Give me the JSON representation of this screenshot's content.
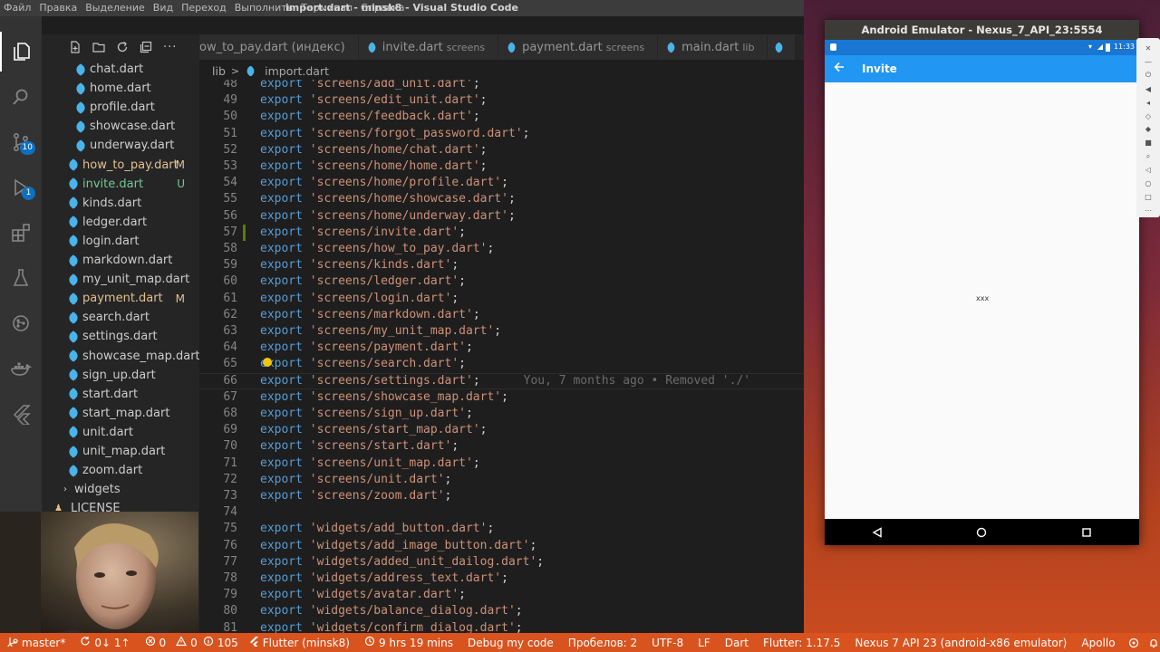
{
  "titlebar": {
    "menu": [
      "Файл",
      "Правка",
      "Выделение",
      "Вид",
      "Переход",
      "Выполнить",
      "Терминал",
      "Справка"
    ],
    "title": "import.dart - minsk8 - Visual Studio Code"
  },
  "activitybar": {
    "items": [
      {
        "name": "explorer-icon",
        "badge": ""
      },
      {
        "name": "search-icon",
        "badge": ""
      },
      {
        "name": "source-control-icon",
        "badge": "10"
      },
      {
        "name": "run-debug-icon",
        "badge": "1"
      },
      {
        "name": "extensions-icon",
        "badge": ""
      },
      {
        "name": "testing-flask-icon",
        "badge": ""
      },
      {
        "name": "git-graph-icon",
        "badge": ""
      },
      {
        "name": "docker-icon",
        "badge": ""
      },
      {
        "name": "flutter-icon",
        "badge": ""
      }
    ]
  },
  "explorer": {
    "actions": [
      "new-file-icon",
      "new-folder-icon",
      "refresh-icon",
      "collapse-icon",
      "more-icon"
    ],
    "items": [
      {
        "label": "chat.dart",
        "indent": 2,
        "mod": "",
        "color": "#cccccc",
        "kind": "file"
      },
      {
        "label": "home.dart",
        "indent": 2,
        "mod": "",
        "color": "#cccccc",
        "kind": "file"
      },
      {
        "label": "profile.dart",
        "indent": 2,
        "mod": "",
        "color": "#cccccc",
        "kind": "file"
      },
      {
        "label": "showcase.dart",
        "indent": 2,
        "mod": "",
        "color": "#cccccc",
        "kind": "file"
      },
      {
        "label": "underway.dart",
        "indent": 2,
        "mod": "",
        "color": "#cccccc",
        "kind": "file"
      },
      {
        "label": "how_to_pay.dart",
        "indent": 1,
        "mod": "M",
        "color": "#e2c08d",
        "kind": "file"
      },
      {
        "label": "invite.dart",
        "indent": 1,
        "mod": "U",
        "color": "#73c991",
        "kind": "file"
      },
      {
        "label": "kinds.dart",
        "indent": 1,
        "mod": "",
        "color": "#cccccc",
        "kind": "file"
      },
      {
        "label": "ledger.dart",
        "indent": 1,
        "mod": "",
        "color": "#cccccc",
        "kind": "file"
      },
      {
        "label": "login.dart",
        "indent": 1,
        "mod": "",
        "color": "#cccccc",
        "kind": "file"
      },
      {
        "label": "markdown.dart",
        "indent": 1,
        "mod": "",
        "color": "#cccccc",
        "kind": "file"
      },
      {
        "label": "my_unit_map.dart",
        "indent": 1,
        "mod": "",
        "color": "#cccccc",
        "kind": "file"
      },
      {
        "label": "payment.dart",
        "indent": 1,
        "mod": "M",
        "color": "#e2c08d",
        "kind": "file"
      },
      {
        "label": "search.dart",
        "indent": 1,
        "mod": "",
        "color": "#cccccc",
        "kind": "file"
      },
      {
        "label": "settings.dart",
        "indent": 1,
        "mod": "",
        "color": "#cccccc",
        "kind": "file"
      },
      {
        "label": "showcase_map.dart",
        "indent": 1,
        "mod": "",
        "color": "#cccccc",
        "kind": "file"
      },
      {
        "label": "sign_up.dart",
        "indent": 1,
        "mod": "",
        "color": "#cccccc",
        "kind": "file"
      },
      {
        "label": "start.dart",
        "indent": 1,
        "mod": "",
        "color": "#cccccc",
        "kind": "file"
      },
      {
        "label": "start_map.dart",
        "indent": 1,
        "mod": "",
        "color": "#cccccc",
        "kind": "file"
      },
      {
        "label": "unit.dart",
        "indent": 1,
        "mod": "",
        "color": "#cccccc",
        "kind": "file"
      },
      {
        "label": "unit_map.dart",
        "indent": 1,
        "mod": "",
        "color": "#cccccc",
        "kind": "file"
      },
      {
        "label": "zoom.dart",
        "indent": 1,
        "mod": "",
        "color": "#cccccc",
        "kind": "file"
      },
      {
        "label": "widgets",
        "indent": 0,
        "mod": "",
        "color": "#cccccc",
        "kind": "folder"
      },
      {
        "label": "LICENSE",
        "indent": -1,
        "mod": "",
        "color": "#cccccc",
        "kind": "license"
      }
    ]
  },
  "tabs": [
    {
      "label": "ow_to_pay.dart (индекс)",
      "sub": "",
      "active": false,
      "icon": false
    },
    {
      "label": "invite.dart",
      "sub": "screens",
      "active": false,
      "icon": true
    },
    {
      "label": "payment.dart",
      "sub": "screens",
      "active": false,
      "icon": true
    },
    {
      "label": "main.dart",
      "sub": "lib",
      "active": false,
      "icon": true
    }
  ],
  "breadcrumb": {
    "folder": "lib",
    "sep": ">",
    "file": "import.dart"
  },
  "editor": {
    "current_line": 66,
    "modified_line": 57,
    "bulb_line": 65,
    "blame": "You, 7 months ago • Removed './'",
    "lines": [
      {
        "n": "48",
        "path": "screens/add_unit.dart"
      },
      {
        "n": "49",
        "path": "screens/edit_unit.dart"
      },
      {
        "n": "50",
        "path": "screens/feedback.dart"
      },
      {
        "n": "51",
        "path": "screens/forgot_password.dart"
      },
      {
        "n": "52",
        "path": "screens/home/chat.dart"
      },
      {
        "n": "53",
        "path": "screens/home/home.dart"
      },
      {
        "n": "54",
        "path": "screens/home/profile.dart"
      },
      {
        "n": "55",
        "path": "screens/home/showcase.dart"
      },
      {
        "n": "56",
        "path": "screens/home/underway.dart"
      },
      {
        "n": "57",
        "path": "screens/invite.dart"
      },
      {
        "n": "58",
        "path": "screens/how_to_pay.dart"
      },
      {
        "n": "59",
        "path": "screens/kinds.dart"
      },
      {
        "n": "60",
        "path": "screens/ledger.dart"
      },
      {
        "n": "61",
        "path": "screens/login.dart"
      },
      {
        "n": "62",
        "path": "screens/markdown.dart"
      },
      {
        "n": "63",
        "path": "screens/my_unit_map.dart"
      },
      {
        "n": "64",
        "path": "screens/payment.dart"
      },
      {
        "n": "65",
        "path": "screens/search.dart"
      },
      {
        "n": "66",
        "path": "screens/settings.dart"
      },
      {
        "n": "67",
        "path": "screens/showcase_map.dart"
      },
      {
        "n": "68",
        "path": "screens/sign_up.dart"
      },
      {
        "n": "69",
        "path": "screens/start_map.dart"
      },
      {
        "n": "70",
        "path": "screens/start.dart"
      },
      {
        "n": "71",
        "path": "screens/unit_map.dart"
      },
      {
        "n": "72",
        "path": "screens/unit.dart"
      },
      {
        "n": "73",
        "path": "screens/zoom.dart"
      },
      {
        "n": "74",
        "path": ""
      },
      {
        "n": "75",
        "path": "widgets/add_button.dart"
      },
      {
        "n": "76",
        "path": "widgets/add_image_button.dart"
      },
      {
        "n": "77",
        "path": "widgets/added_unit_dailog.dart"
      },
      {
        "n": "78",
        "path": "widgets/address_text.dart"
      },
      {
        "n": "79",
        "path": "widgets/avatar.dart"
      },
      {
        "n": "80",
        "path": "widgets/balance_dialog.dart"
      },
      {
        "n": "81",
        "path": "widgets/confirm_dialog.dart"
      }
    ],
    "keyword": "export"
  },
  "statusbar": {
    "left": [
      {
        "icon": "branch-icon",
        "label": "master*"
      },
      {
        "icon": "sync-icon",
        "label": "0↓ 1↑"
      },
      {
        "icon": "error-icon",
        "label": "0"
      },
      {
        "icon": "warning-icon",
        "label": "0"
      },
      {
        "icon": "info-icon",
        "label": "105"
      },
      {
        "icon": "flutter-small-icon",
        "label": "Flutter (minsk8)"
      },
      {
        "icon": "clock-icon",
        "label": "9 hrs 19 mins"
      },
      {
        "icon": "",
        "label": "Debug my code"
      }
    ],
    "right": [
      {
        "icon": "",
        "label": "Пробелов: 2"
      },
      {
        "icon": "",
        "label": "UTF-8"
      },
      {
        "icon": "",
        "label": "LF"
      },
      {
        "icon": "",
        "label": "Dart"
      },
      {
        "icon": "",
        "label": "Flutter: 1.17.5"
      },
      {
        "icon": "",
        "label": "Nexus 7 API 23 (android-x86 emulator)"
      },
      {
        "icon": "",
        "label": "Apollo"
      }
    ],
    "color": "#d9531e"
  },
  "emulator": {
    "title": "Android Emulator - Nexus_7_API_23:5554",
    "status_time": "11:33",
    "appbar_title": "Invite",
    "body_text": "xxx",
    "appbar_color": "#2196f3",
    "statusbar_color": "#1976d2"
  }
}
